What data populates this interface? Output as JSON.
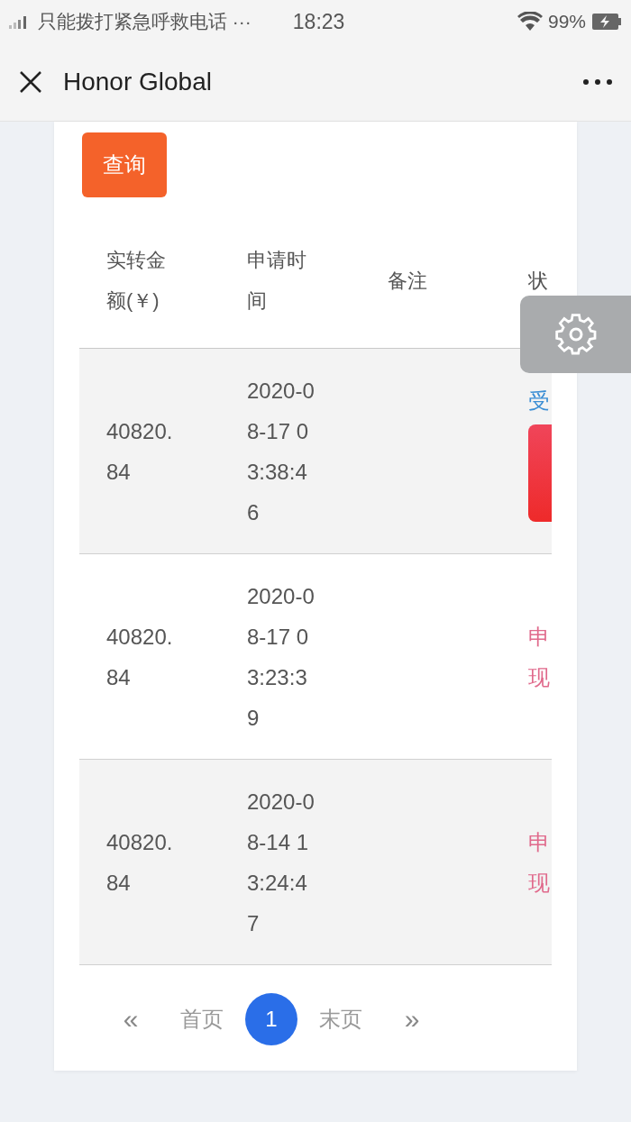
{
  "status_bar": {
    "carrier": "只能拨打紧急呼救电话 ···",
    "time": "18:23",
    "battery": "99%"
  },
  "nav": {
    "title": "Honor Global"
  },
  "query_button": "查询",
  "table": {
    "columns": [
      "实转金额(￥)",
      "申请时间",
      "备注",
      "状"
    ],
    "rows": [
      {
        "amount": "40820.84",
        "time": "2020-08-17 03:38:46",
        "status": "受",
        "kind": "accepted"
      },
      {
        "amount": "40820.84",
        "time": "2020-08-17 03:23:39",
        "status": "申现",
        "kind": "pending"
      },
      {
        "amount": "40820.84",
        "time": "2020-08-14 13:24:47",
        "status": "申现",
        "kind": "pending"
      }
    ]
  },
  "pagination": {
    "prev": "«",
    "first": "首页",
    "pages": [
      {
        "label": "1",
        "selected": true
      }
    ],
    "last": "末页",
    "next": "»"
  }
}
